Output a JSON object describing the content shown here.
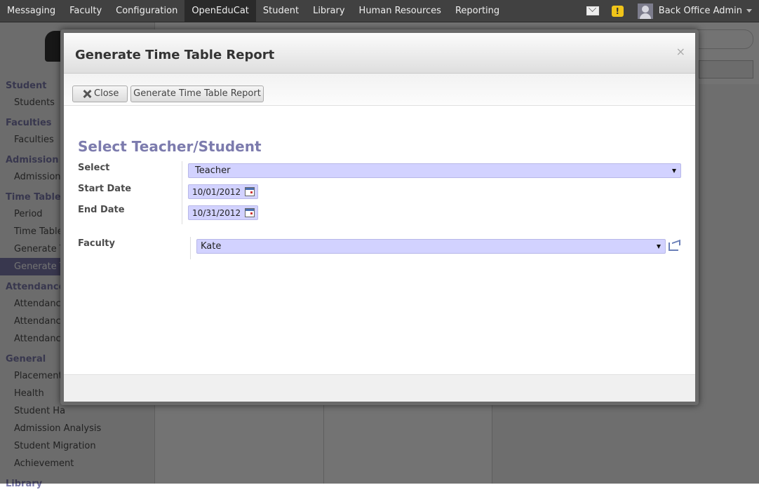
{
  "topbar": {
    "menu": [
      "Messaging",
      "Faculty",
      "Configuration",
      "OpenEduCat",
      "Student",
      "Library",
      "Human Resources",
      "Reporting"
    ],
    "active_menu": "OpenEduCat",
    "user_name": "Back Office Admin",
    "warn_symbol": "!"
  },
  "sidebar": {
    "sections": [
      {
        "title": "Student",
        "items": [
          "Students"
        ]
      },
      {
        "title": "Faculties",
        "items": [
          "Faculties"
        ]
      },
      {
        "title": "Admission",
        "items": [
          "Admission"
        ]
      },
      {
        "title": "Time Table",
        "items": [
          "Period",
          "Time Table",
          "Generate Ti",
          "Generate T"
        ]
      },
      {
        "title": "Attendance",
        "items": [
          "Attendance",
          "Attendance",
          "Attendance"
        ]
      },
      {
        "title": "General",
        "items": [
          "Placement O",
          "Health",
          "Student Ha",
          "Admission Analysis",
          "Student Migration",
          "Achievement"
        ]
      },
      {
        "title": "Library",
        "items": []
      }
    ],
    "selected_item": "Generate T"
  },
  "dialog": {
    "title": "Generate Time Table Report",
    "close_x": "×",
    "buttons": {
      "close": "Close",
      "generate": "Generate Time Table Report"
    },
    "section_title": "Select Teacher/Student",
    "fields": {
      "select_label": "Select",
      "select_value": "Teacher",
      "start_date_label": "Start Date",
      "start_date_value": "10/01/2012",
      "end_date_label": "End Date",
      "end_date_value": "10/31/2012",
      "faculty_label": "Faculty",
      "faculty_value": "Kate"
    }
  }
}
